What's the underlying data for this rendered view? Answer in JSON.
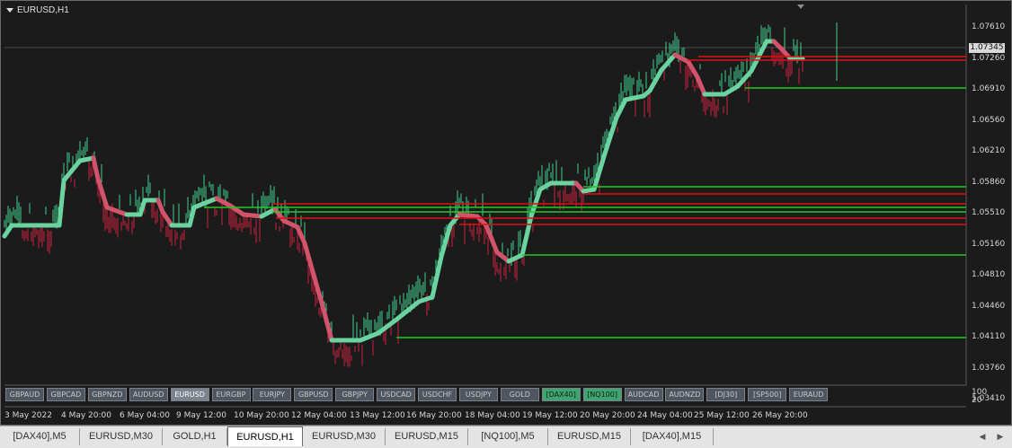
{
  "chart": {
    "title": "EURUSD,H1",
    "current_price": "1.07345",
    "price_labels": [
      "1.07610",
      "1.07260",
      "1.06910",
      "1.06560",
      "1.06210",
      "1.05860",
      "1.05510",
      "1.05160",
      "1.04810",
      "1.04460",
      "1.04110",
      "1.03760",
      "1.03410"
    ],
    "indicator_labels": [
      "100",
      "20"
    ],
    "time_labels": [
      "3 May 2022",
      "4 May 20:00",
      "6 May 04:00",
      "9 May 12:00",
      "10 May 20:00",
      "12 May 04:00",
      "13 May 12:00",
      "16 May 20:00",
      "18 May 04:00",
      "19 May 12:00",
      "20 May 20:00",
      "24 May 04:00",
      "25 May 12:00",
      "26 May 20:00"
    ],
    "symbol_buttons": [
      {
        "label": "GBPAUD",
        "state": "normal"
      },
      {
        "label": "GBPCAD",
        "state": "normal"
      },
      {
        "label": "GBPNZD",
        "state": "normal"
      },
      {
        "label": "AUDUSD",
        "state": "normal"
      },
      {
        "label": "EURUSD",
        "state": "selected"
      },
      {
        "label": "EURGBP",
        "state": "normal"
      },
      {
        "label": "EURJPY",
        "state": "normal"
      },
      {
        "label": "GBPUSD",
        "state": "normal"
      },
      {
        "label": "GBPJPY",
        "state": "normal"
      },
      {
        "label": "USDCAD",
        "state": "normal"
      },
      {
        "label": "USDCHF",
        "state": "normal"
      },
      {
        "label": "USDJPY",
        "state": "normal"
      },
      {
        "label": "GOLD",
        "state": "normal"
      },
      {
        "label": "[DAX40]",
        "state": "green"
      },
      {
        "label": "[NQ100]",
        "state": "green"
      },
      {
        "label": "AUDCAD",
        "state": "normal"
      },
      {
        "label": "AUDNZD",
        "state": "normal"
      },
      {
        "label": "[DJ30]",
        "state": "normal"
      },
      {
        "label": "[SP500]",
        "state": "normal"
      },
      {
        "label": "EURAUD",
        "state": "normal"
      }
    ],
    "colors": {
      "bull": "#3fcf8e",
      "bear": "#c8203c",
      "trail_up": "#6ad3a0",
      "trail_down": "#d2546a",
      "support": "#22c922",
      "resistance": "#e01010"
    }
  },
  "tabs": [
    {
      "label": "[DAX40],M5",
      "active": false
    },
    {
      "label": "EURUSD,M30",
      "active": false
    },
    {
      "label": "GOLD,H1",
      "active": false
    },
    {
      "label": "EURUSD,H1",
      "active": true
    },
    {
      "label": "EURUSD,M30",
      "active": false
    },
    {
      "label": "EURUSD,M15",
      "active": false
    },
    {
      "label": "[NQ100],M5",
      "active": false
    },
    {
      "label": "EURUSD,M15",
      "active": false
    },
    {
      "label": "[DAX40],M15",
      "active": false
    }
  ],
  "tab_nav": {
    "left_icon": "triangle-left-icon",
    "right_icon": "triangle-right-icon"
  }
}
